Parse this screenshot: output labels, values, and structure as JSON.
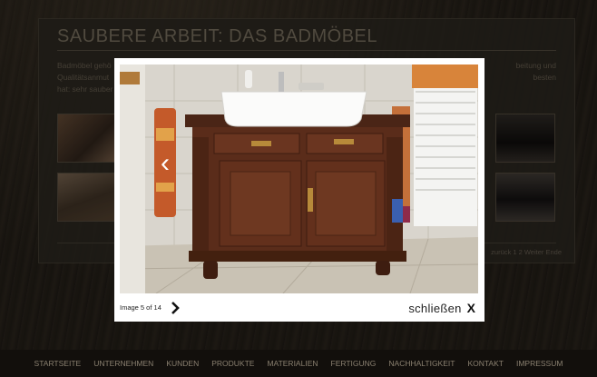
{
  "page": {
    "heading": "Saubere Arbeit: Das Badmöbel",
    "intro_line1_left": "Badmöbel gehö",
    "intro_line1_right": "beitung und",
    "intro_line2_left": "Qualitätsanmut",
    "intro_line2_right": "besten",
    "intro_line3_left": "hat: sehr sauber",
    "pager": "zurück 1 2 Weiter Ende"
  },
  "lightbox": {
    "prev_icon": "chevron-left-icon",
    "next_icon": "chevron-right-icon",
    "counter": "Image 5 of 14",
    "close_label": "schließen",
    "close_glyph": "X"
  },
  "nav": {
    "items": [
      "Startseite",
      "Unternehmen",
      "Kunden",
      "Produkte",
      "Materialien",
      "Fertigung",
      "Nachhaltigkeit",
      "Kontakt",
      "Impressum"
    ]
  }
}
